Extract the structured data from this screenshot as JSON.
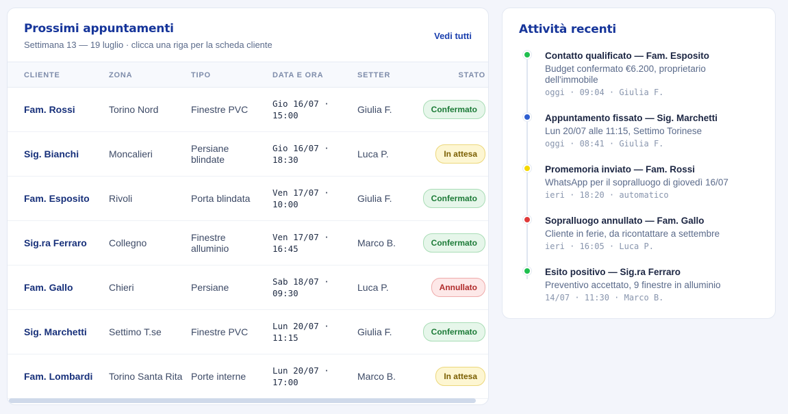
{
  "appointments": {
    "title": "Prossimi appuntamenti",
    "subtitle": "Settimana 13 — 19 luglio · clicca una riga per la scheda cliente",
    "view_all": "Vedi tutti",
    "columns": [
      "CLIENTE",
      "ZONA",
      "TIPO",
      "DATA E ORA",
      "SETTER",
      "STATO"
    ],
    "rows": [
      {
        "client": "Fam. Rossi",
        "zone": "Torino Nord",
        "type": "Finestre PVC",
        "datetime": "Gio 16/07 · 15:00",
        "setter": "Giulia F.",
        "status": "Confermato",
        "status_kind": "ok"
      },
      {
        "client": "Sig. Bianchi",
        "zone": "Moncalieri",
        "type": "Persiane blindate",
        "datetime": "Gio 16/07 · 18:30",
        "setter": "Luca P.",
        "status": "In attesa",
        "status_kind": "wait"
      },
      {
        "client": "Fam. Esposito",
        "zone": "Rivoli",
        "type": "Porta blindata",
        "datetime": "Ven 17/07 · 10:00",
        "setter": "Giulia F.",
        "status": "Confermato",
        "status_kind": "ok"
      },
      {
        "client": "Sig.ra Ferraro",
        "zone": "Collegno",
        "type": "Finestre alluminio",
        "datetime": "Ven 17/07 · 16:45",
        "setter": "Marco B.",
        "status": "Confermato",
        "status_kind": "ok"
      },
      {
        "client": "Fam. Gallo",
        "zone": "Chieri",
        "type": "Persiane",
        "datetime": "Sab 18/07 · 09:30",
        "setter": "Luca P.",
        "status": "Annullato",
        "status_kind": "ko"
      },
      {
        "client": "Sig. Marchetti",
        "zone": "Settimo T.se",
        "type": "Finestre PVC",
        "datetime": "Lun 20/07 · 11:15",
        "setter": "Giulia F.",
        "status": "Confermato",
        "status_kind": "ok"
      },
      {
        "client": "Fam. Lombardi",
        "zone": "Torino Santa Rita",
        "type": "Porte interne",
        "datetime": "Lun 20/07 · 17:00",
        "setter": "Marco B.",
        "status": "In attesa",
        "status_kind": "wait"
      }
    ]
  },
  "activity": {
    "title": "Attività recenti",
    "items": [
      {
        "title": "Contatto qualificato — Fam. Esposito",
        "desc": "Budget confermato €6.200, proprietario dell'immobile",
        "meta": "oggi · 09:04 · Giulia F.",
        "color": "#1fbf4f"
      },
      {
        "title": "Appuntamento fissato — Sig. Marchetti",
        "desc": "Lun 20/07 alle 11:15, Settimo Torinese",
        "meta": "oggi · 08:41 · Giulia F.",
        "color": "#2f5fd0"
      },
      {
        "title": "Promemoria inviato — Fam. Rossi",
        "desc": "WhatsApp per il sopralluogo di giovedì 16/07",
        "meta": "ieri · 18:20 · automatico",
        "color": "#f5d800"
      },
      {
        "title": "Sopralluogo annullato — Fam. Gallo",
        "desc": "Cliente in ferie, da ricontattare a settembre",
        "meta": "ieri · 16:05 · Luca P.",
        "color": "#e03a3a"
      },
      {
        "title": "Esito positivo — Sig.ra Ferraro",
        "desc": "Preventivo accettato, 9 finestre in alluminio",
        "meta": "14/07 · 11:30 · Marco B.",
        "color": "#1fbf4f"
      }
    ]
  }
}
